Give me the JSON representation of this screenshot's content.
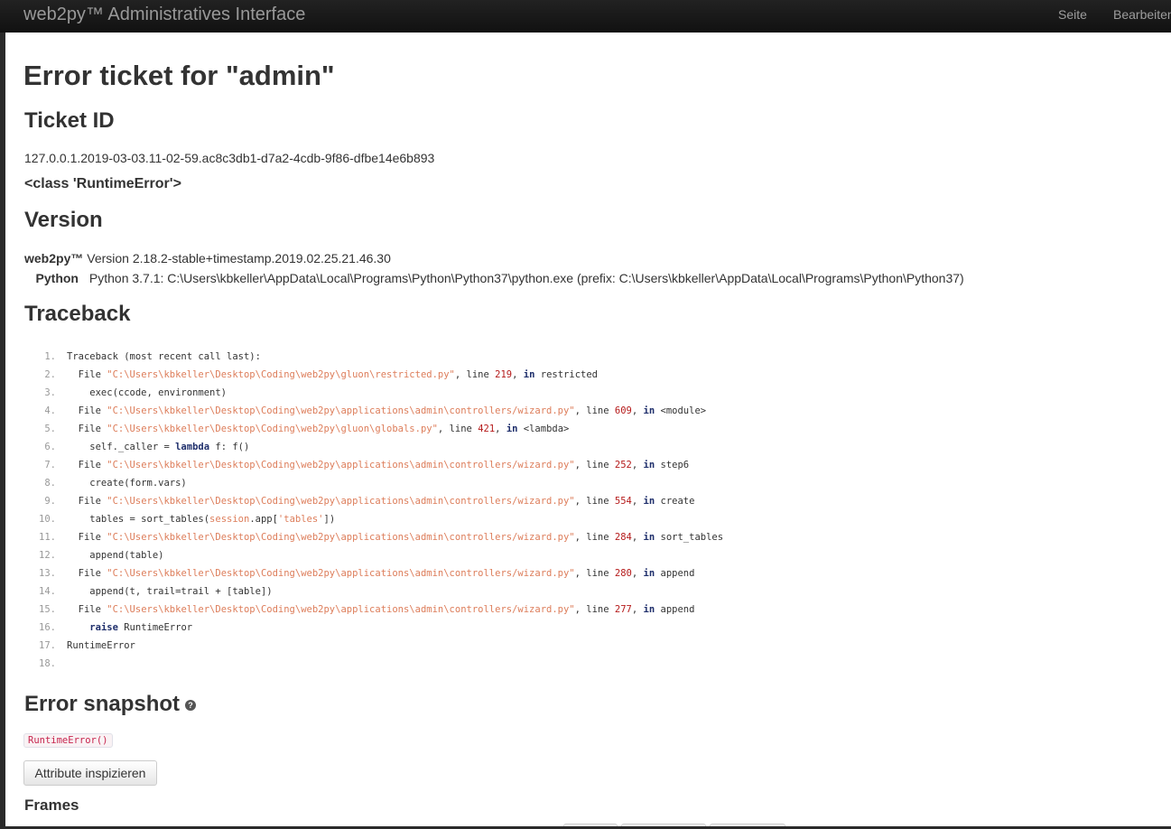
{
  "navbar": {
    "brand": "web2py™ Administratives Interface",
    "links": [
      "Seite",
      "Bearbeiten"
    ]
  },
  "page": {
    "title": "Error ticket for \"admin\"",
    "ticket_heading": "Ticket ID",
    "ticket_id": "127.0.0.1.2019-03-03.11-02-59.ac8c3db1-d7a2-4cdb-9f86-dfbe14e6b893",
    "error_class": "<class 'RuntimeError'>",
    "version_heading": "Version",
    "version_rows": [
      {
        "key": "web2py™",
        "value": "Version 2.18.2-stable+timestamp.2019.02.25.21.46.30"
      },
      {
        "key": "Python",
        "value": "Python 3.7.1: C:\\Users\\kbkeller\\AppData\\Local\\Programs\\Python\\Python37\\python.exe (prefix: C:\\Users\\kbkeller\\AppData\\Local\\Programs\\Python\\Python37)"
      }
    ],
    "traceback_heading": "Traceback",
    "traceback_lines": [
      {
        "num": "1.",
        "parts": [
          [
            "",
            "Traceback (most recent call last):"
          ]
        ]
      },
      {
        "num": "2.",
        "parts": [
          [
            "",
            "  File "
          ],
          [
            "str",
            "\"C:\\Users\\kbkeller\\Desktop\\Coding\\web2py\\gluon\\restricted.py\""
          ],
          [
            "",
            ", line "
          ],
          [
            "num",
            "219"
          ],
          [
            "",
            ", "
          ],
          [
            "kw",
            "in"
          ],
          [
            "",
            " restricted"
          ]
        ]
      },
      {
        "num": "3.",
        "parts": [
          [
            "",
            "    exec(ccode, environment)"
          ]
        ]
      },
      {
        "num": "4.",
        "parts": [
          [
            "",
            "  File "
          ],
          [
            "str",
            "\"C:\\Users\\kbkeller\\Desktop\\Coding\\web2py\\applications\\admin\\controllers/wizard.py\""
          ],
          [
            "",
            ", line "
          ],
          [
            "num",
            "609"
          ],
          [
            "",
            ", "
          ],
          [
            "kw",
            "in"
          ],
          [
            "",
            " <module>"
          ]
        ]
      },
      {
        "num": "5.",
        "parts": [
          [
            "",
            "  File "
          ],
          [
            "str",
            "\"C:\\Users\\kbkeller\\Desktop\\Coding\\web2py\\gluon\\globals.py\""
          ],
          [
            "",
            ", line "
          ],
          [
            "num",
            "421"
          ],
          [
            "",
            ", "
          ],
          [
            "kw",
            "in"
          ],
          [
            "",
            " <lambda>"
          ]
        ]
      },
      {
        "num": "6.",
        "parts": [
          [
            "",
            "    self._caller = "
          ],
          [
            "kw",
            "lambda"
          ],
          [
            "",
            " f: f()"
          ]
        ]
      },
      {
        "num": "7.",
        "parts": [
          [
            "",
            "  File "
          ],
          [
            "str",
            "\"C:\\Users\\kbkeller\\Desktop\\Coding\\web2py\\applications\\admin\\controllers/wizard.py\""
          ],
          [
            "",
            ", line "
          ],
          [
            "num",
            "252"
          ],
          [
            "",
            ", "
          ],
          [
            "kw",
            "in"
          ],
          [
            "",
            " step6"
          ]
        ]
      },
      {
        "num": "8.",
        "parts": [
          [
            "",
            "    create(form.vars)"
          ]
        ]
      },
      {
        "num": "9.",
        "parts": [
          [
            "",
            "  File "
          ],
          [
            "str",
            "\"C:\\Users\\kbkeller\\Desktop\\Coding\\web2py\\applications\\admin\\controllers/wizard.py\""
          ],
          [
            "",
            ", line "
          ],
          [
            "num",
            "554"
          ],
          [
            "",
            ", "
          ],
          [
            "kw",
            "in"
          ],
          [
            "",
            " create"
          ]
        ]
      },
      {
        "num": "10.",
        "parts": [
          [
            "",
            "    tables = sort_tables("
          ],
          [
            "str",
            "session"
          ],
          [
            "",
            ".app["
          ],
          [
            "str",
            "'tables'"
          ],
          [
            "",
            "])"
          ]
        ]
      },
      {
        "num": "11.",
        "parts": [
          [
            "",
            "  File "
          ],
          [
            "str",
            "\"C:\\Users\\kbkeller\\Desktop\\Coding\\web2py\\applications\\admin\\controllers/wizard.py\""
          ],
          [
            "",
            ", line "
          ],
          [
            "num",
            "284"
          ],
          [
            "",
            ", "
          ],
          [
            "kw",
            "in"
          ],
          [
            "",
            " sort_tables"
          ]
        ]
      },
      {
        "num": "12.",
        "parts": [
          [
            "",
            "    append(table)"
          ]
        ]
      },
      {
        "num": "13.",
        "parts": [
          [
            "",
            "  File "
          ],
          [
            "str",
            "\"C:\\Users\\kbkeller\\Desktop\\Coding\\web2py\\applications\\admin\\controllers/wizard.py\""
          ],
          [
            "",
            ", line "
          ],
          [
            "num",
            "280"
          ],
          [
            "",
            ", "
          ],
          [
            "kw",
            "in"
          ],
          [
            "",
            " append"
          ]
        ]
      },
      {
        "num": "14.",
        "parts": [
          [
            "",
            "    append(t, trail=trail + [table])"
          ]
        ]
      },
      {
        "num": "15.",
        "parts": [
          [
            "",
            "  File "
          ],
          [
            "str",
            "\"C:\\Users\\kbkeller\\Desktop\\Coding\\web2py\\applications\\admin\\controllers/wizard.py\""
          ],
          [
            "",
            ", line "
          ],
          [
            "num",
            "277"
          ],
          [
            "",
            ", "
          ],
          [
            "kw",
            "in"
          ],
          [
            "",
            " append"
          ]
        ]
      },
      {
        "num": "16.",
        "parts": [
          [
            "",
            "    "
          ],
          [
            "kw",
            "raise"
          ],
          [
            "",
            " RuntimeError"
          ]
        ]
      },
      {
        "num": "17.",
        "parts": [
          [
            "",
            "RuntimeError"
          ]
        ]
      },
      {
        "num": "18.",
        "parts": [
          [
            "",
            ""
          ]
        ]
      }
    ],
    "snapshot_heading": "Error snapshot",
    "snapshot_help_icon": "question-circle-icon",
    "snapshot_value": "RuntimeError()",
    "inspect_button": "Attribute inspizieren",
    "frames_heading": "Frames"
  }
}
